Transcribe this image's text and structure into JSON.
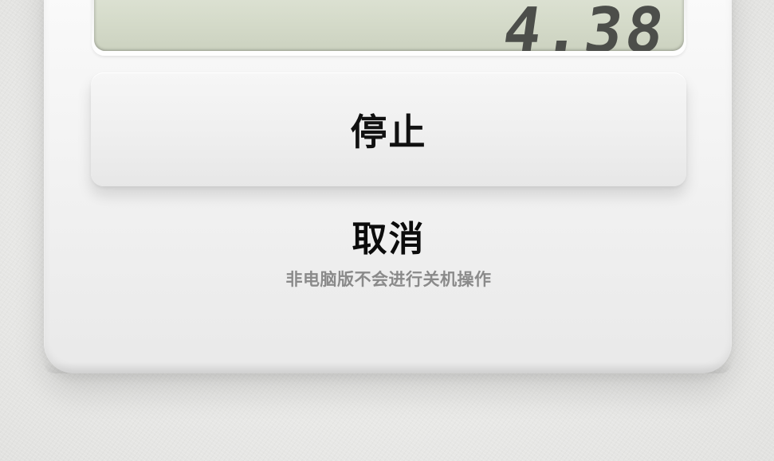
{
  "display": {
    "readout": "4.38"
  },
  "buttons": {
    "stop_label": "停止",
    "cancel_label": "取消",
    "cancel_note": "非电脑版不会进行关机操作"
  }
}
